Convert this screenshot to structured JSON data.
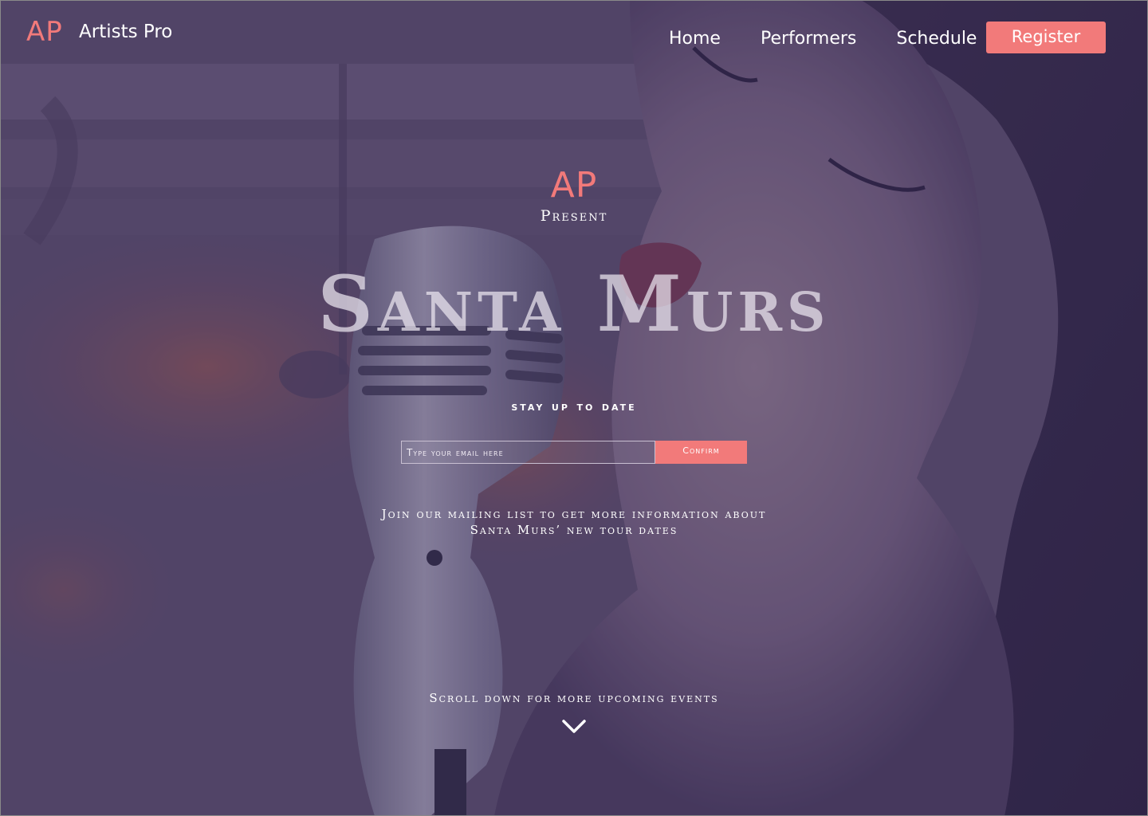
{
  "header": {
    "logo_mark": "AP",
    "logo_name": "Artists Pro",
    "nav": [
      {
        "label": "Home"
      },
      {
        "label": "Performers"
      },
      {
        "label": "Schedule"
      }
    ],
    "register_label": "Register"
  },
  "hero": {
    "logo_mark": "AP",
    "present": "Present",
    "artist_name": "Santa Murs",
    "background_image": "singer-with-vintage-microphone-photo"
  },
  "subscribe": {
    "heading": "stay up to date",
    "email_placeholder": "Type your email here",
    "confirm_label": "Confirm",
    "description_line1": "Join our mailing list to get more information about",
    "description_line2": "Santa Murs’ new tour dates"
  },
  "footer": {
    "scroll_text": "Scroll down for more upcoming events",
    "scroll_icon": "chevron-down-icon"
  },
  "colors": {
    "accent": "#f27a7a",
    "overlay": "#3a2f55",
    "text": "#ffffff"
  }
}
